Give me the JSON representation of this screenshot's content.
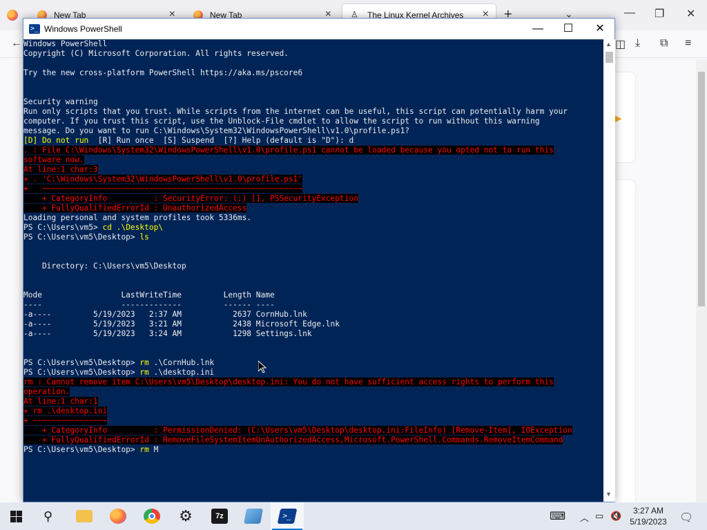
{
  "browser": {
    "tabs": [
      {
        "label": "New Tab",
        "active": false
      },
      {
        "label": "New Tab",
        "active": false
      },
      {
        "label": "The Linux Kernel Archives",
        "active": true
      }
    ]
  },
  "powershell": {
    "title": "Windows PowerShell",
    "lines": [
      [
        {
          "t": "Windows PowerShell",
          "c": "white"
        }
      ],
      [
        {
          "t": "Copyright (C) Microsoft Corporation. All rights reserved.",
          "c": "white"
        }
      ],
      [],
      [
        {
          "t": "Try the new cross-platform PowerShell https://aka.ms/pscore6",
          "c": "white"
        }
      ],
      [],
      [],
      [
        {
          "t": "Security warning",
          "c": "white"
        }
      ],
      [
        {
          "t": "Run only scripts that you trust. While scripts from the internet can be useful, this script can potentially harm your",
          "c": "white"
        }
      ],
      [
        {
          "t": "computer. If you trust this script, use the Unblock-File cmdlet to allow the script to run without this warning",
          "c": "white"
        }
      ],
      [
        {
          "t": "message. Do you want to run C:\\Windows\\System32\\WindowsPowerShell\\v1.0\\profile.ps1?",
          "c": "white"
        }
      ],
      [
        {
          "t": "[D] Do not run  ",
          "c": "yellow"
        },
        {
          "t": "[R] Run once  [S] Suspend  [?] Help (default is \"D\"): d",
          "c": "white"
        }
      ],
      [
        {
          "t": ". : File C:\\Windows\\System32\\WindowsPowerShell\\v1.0\\profile.ps1 cannot be loaded because you opted not to run this",
          "c": "err"
        }
      ],
      [
        {
          "t": "software now.",
          "c": "err"
        }
      ],
      [
        {
          "t": "At line:1 char:3",
          "c": "err"
        }
      ],
      [
        {
          "t": "+ . 'C:\\Windows\\System32\\WindowsPowerShell\\v1.0\\profile.ps1'",
          "c": "err"
        }
      ],
      [
        {
          "t": "+   ~~~~~~~~~~~~~~~~~~~~~~~~~~~~~~~~~~~~~~~~~~~~~~~~~~~~~~~~",
          "c": "err"
        }
      ],
      [
        {
          "t": "    + CategoryInfo          : SecurityError: (:) [], PSSecurityException",
          "c": "err"
        }
      ],
      [
        {
          "t": "    + FullyQualifiedErrorId : UnauthorizedAccess",
          "c": "err"
        }
      ],
      [
        {
          "t": "Loading personal and system profiles took 5336ms.",
          "c": "white"
        }
      ],
      [
        {
          "t": "PS C:\\Users\\vm5> ",
          "c": "white"
        },
        {
          "t": "cd .\\Desktop\\",
          "c": "yellow"
        }
      ],
      [
        {
          "t": "PS C:\\Users\\vm5\\Desktop> ",
          "c": "white"
        },
        {
          "t": "ls",
          "c": "yellow"
        }
      ],
      [],
      [],
      [
        {
          "t": "    Directory: C:\\Users\\vm5\\Desktop",
          "c": "white"
        }
      ],
      [],
      [],
      [
        {
          "t": "Mode                 LastWriteTime         Length Name",
          "c": "white"
        }
      ],
      [
        {
          "t": "----                 -------------         ------ ----",
          "c": "white"
        }
      ],
      [
        {
          "t": "-a----         5/19/2023   2:37 AM           2637 CornHub.lnk",
          "c": "white"
        }
      ],
      [
        {
          "t": "-a----         5/19/2023   3:21 AM           2438 Microsoft Edge.lnk",
          "c": "white"
        }
      ],
      [
        {
          "t": "-a----         5/19/2023   3:24 AM           1298 Settings.lnk",
          "c": "white"
        }
      ],
      [],
      [],
      [
        {
          "t": "PS C:\\Users\\vm5\\Desktop> ",
          "c": "white"
        },
        {
          "t": "rm ",
          "c": "yellow"
        },
        {
          "t": ".\\CornHub.lnk",
          "c": "white"
        }
      ],
      [
        {
          "t": "PS C:\\Users\\vm5\\Desktop> ",
          "c": "white"
        },
        {
          "t": "rm ",
          "c": "yellow"
        },
        {
          "t": ".\\desktop.ini",
          "c": "white"
        }
      ],
      [
        {
          "t": "rm : Cannot remove item C:\\Users\\vm5\\Desktop\\desktop.ini: You do not have sufficient access rights to perform this",
          "c": "err"
        }
      ],
      [
        {
          "t": "operation.",
          "c": "err"
        }
      ],
      [
        {
          "t": "At line:1 char:1",
          "c": "err"
        }
      ],
      [
        {
          "t": "+ rm .\\desktop.ini",
          "c": "err"
        }
      ],
      [
        {
          "t": "+ ~~~~~~~~~~~~~~~~",
          "c": "err"
        }
      ],
      [
        {
          "t": "    + CategoryInfo          : PermissionDenied: (C:\\Users\\vm5\\Desktop\\desktop.ini:FileInfo) [Remove-Item], IOException",
          "c": "err"
        }
      ],
      [
        {
          "t": "    + FullyQualifiedErrorId : RemoveFileSystemItemUnAuthorizedAccess,Microsoft.PowerShell.Commands.RemoveItemCommand",
          "c": "err"
        }
      ],
      [
        {
          "t": "PS C:\\Users\\vm5\\Desktop> ",
          "c": "white"
        },
        {
          "t": "rm ",
          "c": "yellow"
        },
        {
          "t": "M",
          "c": "white"
        }
      ]
    ]
  },
  "taskbar": {
    "apps": [
      {
        "name": "file-explorer",
        "icon": "folder-icon",
        "color": "#f2c14e"
      },
      {
        "name": "firefox",
        "icon": "firefox-icon",
        "color": "#ff7139"
      },
      {
        "name": "chrome",
        "icon": "chrome-icon",
        "color": "#34a853"
      },
      {
        "name": "settings",
        "icon": "gear-icon",
        "color": "#1a1a1a"
      },
      {
        "name": "7zip",
        "icon": "7zip-icon",
        "color": "#1a1a1a"
      },
      {
        "name": "notepad",
        "icon": "notepad-icon",
        "color": "#79b8e8"
      },
      {
        "name": "powershell",
        "icon": "powershell-icon",
        "color": "#0a3e8c"
      }
    ],
    "clock": {
      "time": "3:27 AM",
      "date": "5/19/2023"
    }
  },
  "colors": {
    "console_bg": "#012456",
    "accent": "#0078d7"
  }
}
